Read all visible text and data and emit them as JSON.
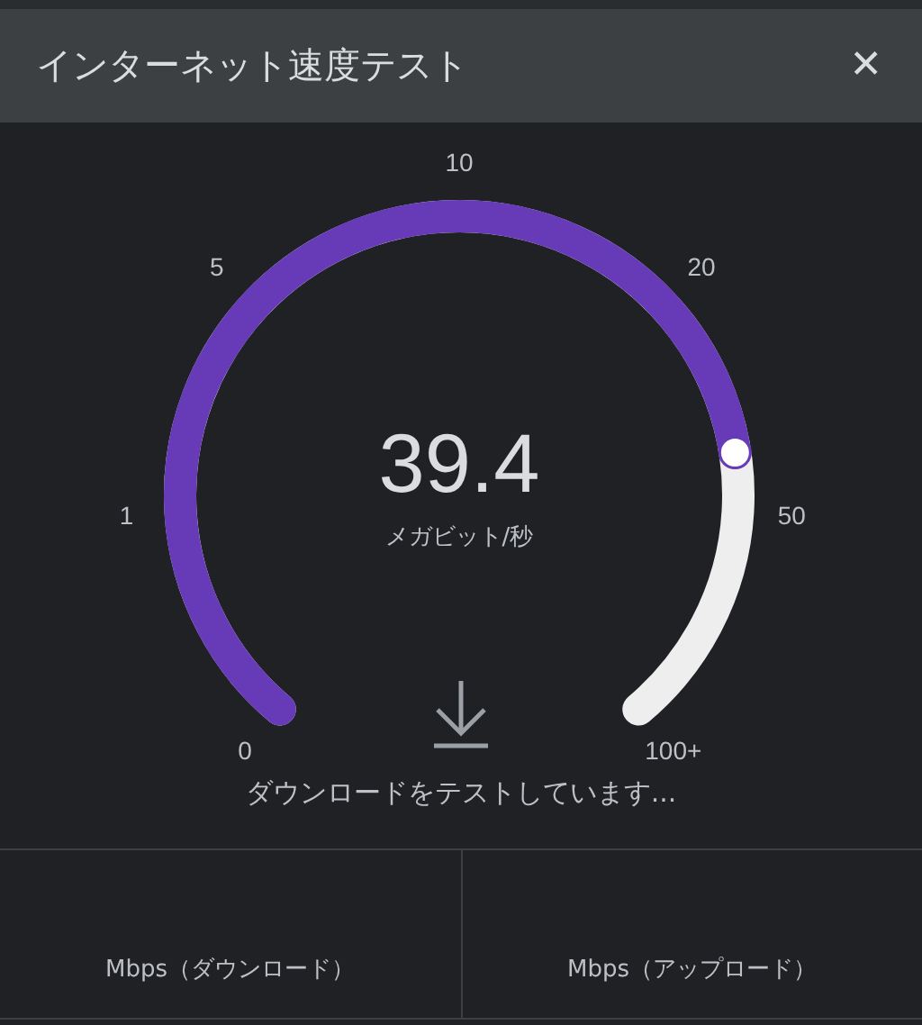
{
  "window": {
    "title": "インターネット速度テスト",
    "close": "✕"
  },
  "gauge": {
    "ticks": [
      "0",
      "1",
      "5",
      "10",
      "20",
      "50",
      "100+"
    ],
    "level": 0.79,
    "value": "39.4",
    "unit": "メガビット/秒"
  },
  "status": "ダウンロードをテストしています...",
  "results": [
    {
      "label": "Mbps（ダウンロード）"
    },
    {
      "label": "Mbps（アップロード）"
    }
  ]
}
